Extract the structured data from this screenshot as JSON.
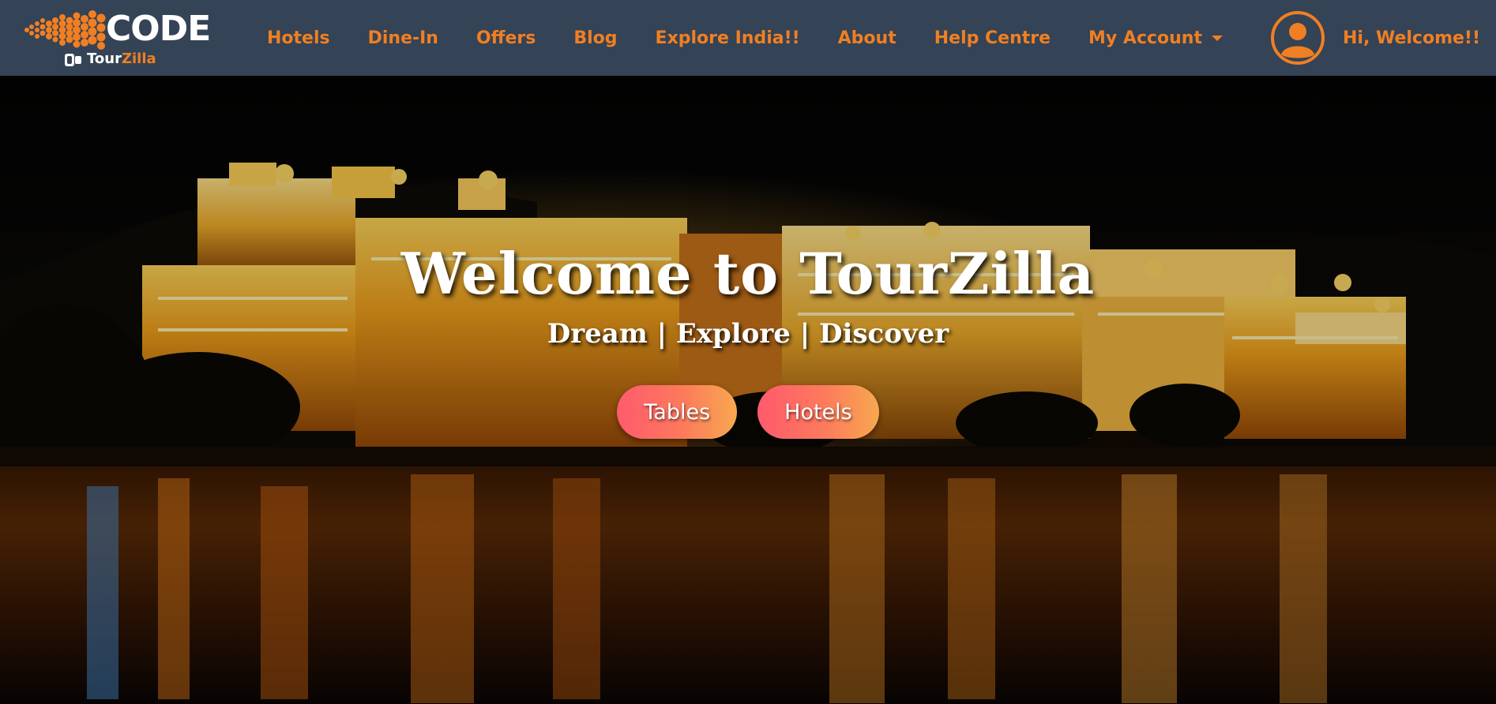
{
  "brand": {
    "logo_word": "CODE",
    "sub_tour": "Tour",
    "sub_zilla": "Zilla",
    "accent_color": "#f07f23",
    "navbar_color": "#344355"
  },
  "nav": {
    "items": [
      {
        "label": "Hotels"
      },
      {
        "label": "Dine-In"
      },
      {
        "label": "Offers"
      },
      {
        "label": "Blog"
      },
      {
        "label": "Explore India!!"
      },
      {
        "label": "About"
      },
      {
        "label": "Help Centre"
      },
      {
        "label": "My Account"
      }
    ],
    "user_icon": "user-circle-icon",
    "greeting": "Hi, Welcome!!"
  },
  "hero": {
    "title": "Welcome to TourZilla",
    "subtitle": "Dream | Explore | Discover",
    "buttons": [
      {
        "label": "Tables"
      },
      {
        "label": "Hotels"
      }
    ],
    "button_gradient": [
      "#ff5a6d",
      "#f7a850"
    ]
  }
}
